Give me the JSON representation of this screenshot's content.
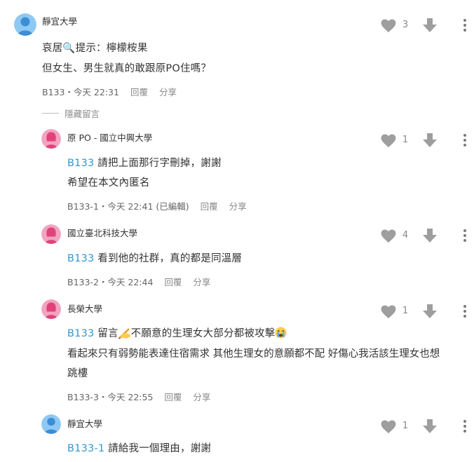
{
  "colors": {
    "mention": "#3397cf",
    "avatar_blue": "#5aa9e6",
    "avatar_pink": "#ea7aa0",
    "icon_gray": "#9e9e9e"
  },
  "comments": [
    {
      "author": "靜宜大學",
      "avatar": "blue-person-icon",
      "lines": [
        "哀居🔍提示：檸檬桉果",
        "但女生、男生就真的敢跟原PO住嗎？"
      ],
      "meta": "B133・今天 22:31",
      "likes": "3"
    },
    {
      "author": "原 PO - 國立中興大學",
      "avatar": "pink-person-icon",
      "mention": "B133",
      "lines": [
        "請把上面那行字刪掉，謝謝",
        "希望在本文內匿名"
      ],
      "meta": "B133-1・今天 22:41 (已編輯)",
      "likes": "1"
    },
    {
      "author": "國立臺北科技大學",
      "avatar": "pink-person-icon",
      "mention": "B133",
      "lines": [
        "看到他的社群，真的都是同溫層"
      ],
      "meta": "B133-2・今天 22:44",
      "likes": "4"
    },
    {
      "author": "長榮大學",
      "avatar": "pink-person-icon",
      "mention": "B133",
      "lines": [
        "留言",
        "不願意的生理女大部分都被攻擊",
        "看起來只有弱勢能表達住宿需求 其他生理女的意願都不配 好傷心我活該生理女也想",
        "跳樓"
      ],
      "meta": "B133-3・今天 22:55",
      "likes": "1"
    },
    {
      "author": "靜宜大學",
      "avatar": "blue-person-icon",
      "mention": "B133-1",
      "lines": [
        "請給我一個理由，謝謝"
      ],
      "likes": "1"
    }
  ],
  "actions": {
    "reply": "回覆",
    "share": "分享"
  },
  "hide_replies": "隱藏留言"
}
